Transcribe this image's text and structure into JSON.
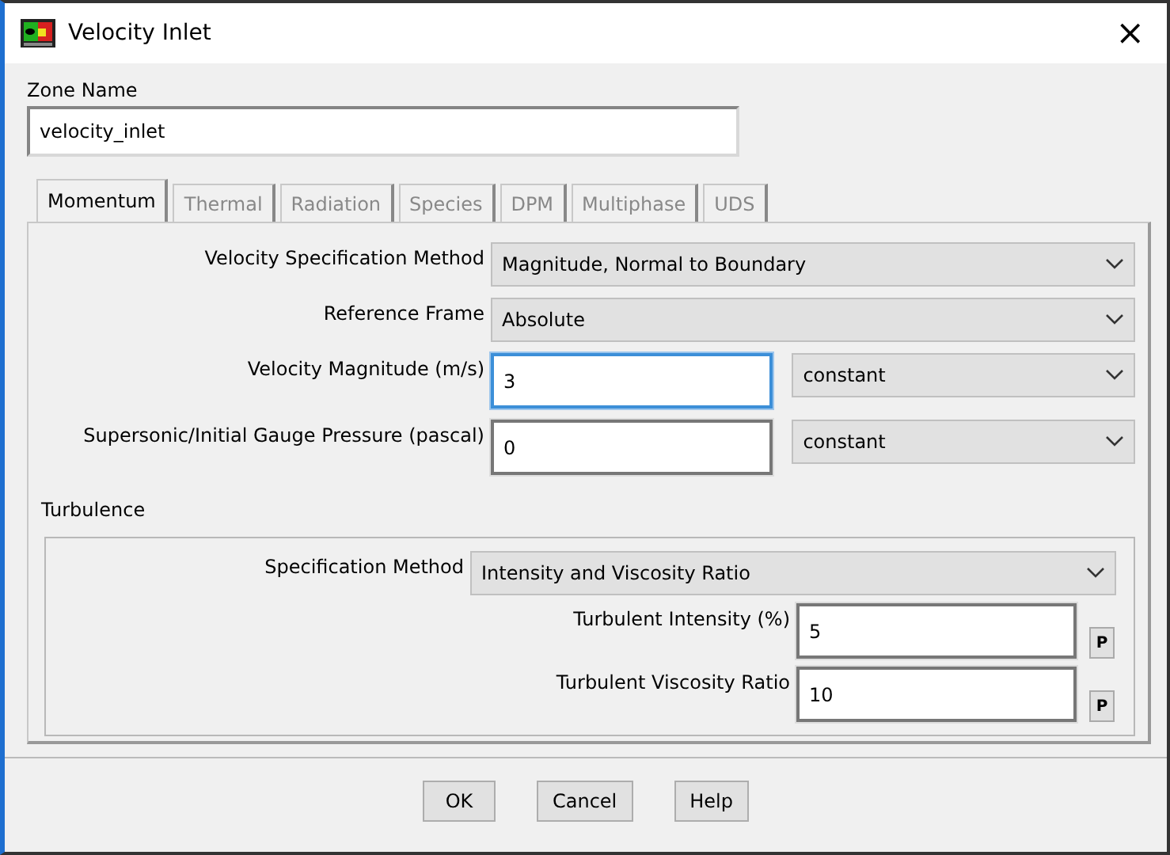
{
  "window": {
    "title": "Velocity Inlet",
    "close": "×"
  },
  "zone_name": {
    "label": "Zone Name",
    "value": "velocity_inlet"
  },
  "tabs": [
    {
      "label": "Momentum",
      "selected": true
    },
    {
      "label": "Thermal",
      "selected": false
    },
    {
      "label": "Radiation",
      "selected": false
    },
    {
      "label": "Species",
      "selected": false
    },
    {
      "label": "DPM",
      "selected": false
    },
    {
      "label": "Multiphase",
      "selected": false
    },
    {
      "label": "UDS",
      "selected": false
    }
  ],
  "momentum_fields": [
    {
      "kind": "dropdown",
      "label": "Velocity Specification Method",
      "value": "Magnitude, Normal to Boundary"
    },
    {
      "kind": "dropdown",
      "label": "Reference Frame",
      "value": "Absolute"
    },
    {
      "kind": "input",
      "label": "Velocity Magnitude (m/s)",
      "value": "3",
      "focused": true,
      "option": "constant"
    },
    {
      "kind": "input",
      "label": "Supersonic/Initial Gauge Pressure (pascal)",
      "value": "0",
      "focused": false,
      "option": "constant"
    }
  ],
  "turbulence": {
    "title": "Turbulence",
    "fields": [
      {
        "kind": "dropdown",
        "label": "Specification Method",
        "value": "Intensity and Viscosity Ratio"
      },
      {
        "kind": "param",
        "label": "Turbulent Intensity (%)",
        "value": "5",
        "button": "P"
      },
      {
        "kind": "param",
        "label": "Turbulent Viscosity Ratio",
        "value": "10",
        "button": "P"
      }
    ]
  },
  "buttons": [
    "OK",
    "Cancel",
    "Help"
  ]
}
